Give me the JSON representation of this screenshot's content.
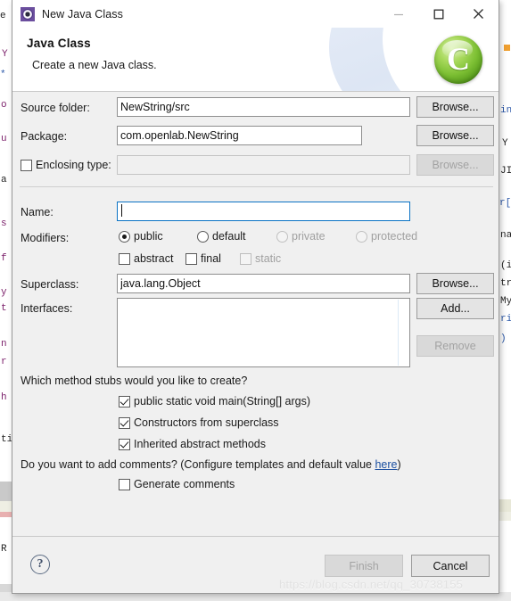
{
  "window": {
    "title": "New Java Class",
    "icon": "java-class-wizard-icon",
    "controls": {
      "minimize": "minimize-icon",
      "maximize": "maximize-icon",
      "close": "close-icon"
    }
  },
  "header": {
    "title": "Java Class",
    "subtitle": "Create a new Java class.",
    "logo_letter": "C"
  },
  "form": {
    "source_folder": {
      "label": "Source folder:",
      "value": "NewString/src",
      "browse_label": "Browse..."
    },
    "package": {
      "label": "Package:",
      "value": "com.openlab.NewString",
      "browse_label": "Browse..."
    },
    "enclosing_type": {
      "label": "Enclosing type:",
      "checked": false,
      "value": "",
      "browse_label": "Browse...",
      "disabled": true
    },
    "name": {
      "label": "Name:",
      "value": "",
      "focused": true
    },
    "modifiers": {
      "label": "Modifiers:",
      "radios": [
        {
          "label": "public",
          "checked": true,
          "disabled": false
        },
        {
          "label": "default",
          "checked": false,
          "disabled": false
        },
        {
          "label": "private",
          "checked": false,
          "disabled": true
        },
        {
          "label": "protected",
          "checked": false,
          "disabled": true
        }
      ],
      "checkboxes": [
        {
          "label": "abstract",
          "checked": false,
          "disabled": false
        },
        {
          "label": "final",
          "checked": false,
          "disabled": false
        },
        {
          "label": "static",
          "checked": false,
          "disabled": true
        }
      ]
    },
    "superclass": {
      "label": "Superclass:",
      "value": "java.lang.Object",
      "browse_label": "Browse..."
    },
    "interfaces": {
      "label": "Interfaces:",
      "items": [],
      "add_label": "Add...",
      "remove_label": "Remove",
      "remove_disabled": true
    }
  },
  "stubs": {
    "question": "Which method stubs would you like to create?",
    "options": [
      {
        "label": "public static void main(String[] args)",
        "checked": true
      },
      {
        "label": "Constructors from superclass",
        "checked": true
      },
      {
        "label": "Inherited abstract methods",
        "checked": true
      }
    ]
  },
  "comments": {
    "question_prefix": "Do you want to add comments? (Configure templates and default value ",
    "link": "here",
    "question_suffix": ")",
    "checkbox": {
      "label": "Generate comments",
      "checked": false
    }
  },
  "footer": {
    "help_glyph": "?",
    "finish_label": "Finish",
    "finish_disabled": true,
    "cancel_label": "Cancel"
  },
  "watermark": "https://blog.csdn.net/qq_30738155",
  "backdrop": {
    "code_left": [
      "o s",
      "u",
      "a",
      "s",
      "f",
      "y",
      "t",
      "n",
      "r",
      "h",
      "ti"
    ],
    "code_right": [
      "in",
      "Y",
      "JI",
      "r[",
      "My",
      "na",
      "(in",
      "tr",
      "My",
      "rin",
      ")"
    ]
  }
}
